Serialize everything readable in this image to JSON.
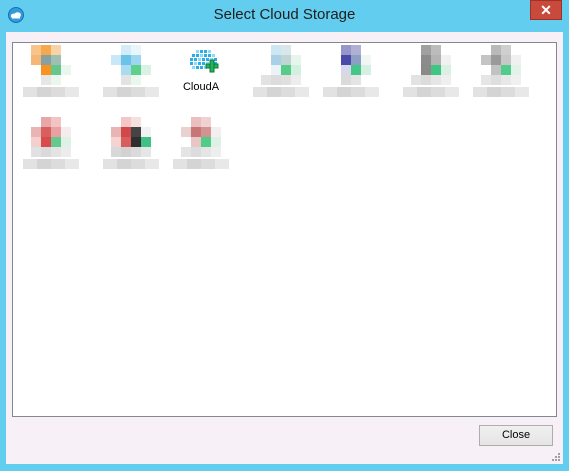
{
  "window": {
    "title": "Select Cloud Storage",
    "close_glyph": "✕"
  },
  "storage_items": [
    {
      "label": "",
      "icon": "blurred-icon",
      "colors": [
        "#f7c489",
        "#f6a94a",
        "#f8d3a8",
        "#fff",
        "#f4b776",
        "#88a0a4",
        "#9ec0b0",
        "#fff",
        "#fff",
        "#f7931e",
        "#66c78c",
        "#e9f7ef",
        "#fff",
        "#e6e6e6",
        "#eaf6ee",
        "#fff"
      ]
    },
    {
      "label": "",
      "icon": "blurred-icon",
      "colors": [
        "#fff",
        "#d3ecf8",
        "#e8f5fb",
        "#fff",
        "#c9e7f6",
        "#6cc3ea",
        "#9fd6ef",
        "#fff",
        "#fff",
        "#a9dbf1",
        "#5fcf8e",
        "#d8f3e4",
        "#fff",
        "#e3e3e3",
        "#e9f7ef",
        "#fff"
      ]
    },
    {
      "label": "CloudA",
      "icon": "clouda-icon",
      "colors": []
    },
    {
      "label": "",
      "icon": "blurred-icon",
      "colors": [
        "#fff",
        "#cce6f2",
        "#d9e6ea",
        "#fff",
        "#fff",
        "#a9d0e6",
        "#c1d6d4",
        "#e8f5ef",
        "#fff",
        "#eaf4f8",
        "#55cc88",
        "#d2f0df",
        "#e2e2e2",
        "#dcdcdc",
        "#e0e0e0",
        "#ededed"
      ]
    },
    {
      "label": "",
      "icon": "blurred-icon",
      "colors": [
        "#fff",
        "#9696c8",
        "#b0b0d4",
        "#fff",
        "#fff",
        "#4a4aa8",
        "#8e9fc6",
        "#f0f6f3",
        "#fff",
        "#d8d8ec",
        "#45c789",
        "#d5efe2",
        "#fff",
        "#dadada",
        "#e4e4e4",
        "#fff"
      ]
    },
    {
      "label": "",
      "icon": "blurred-icon",
      "colors": [
        "#fff",
        "#a0a0a0",
        "#bcbcbc",
        "#fff",
        "#fff",
        "#8c8c8c",
        "#b4b4b4",
        "#f1f1f1",
        "#fff",
        "#8a8a8a",
        "#3fc584",
        "#d9f0e3",
        "#e3e3e3",
        "#dcdcdc",
        "#e6e6e6",
        "#efefef"
      ]
    },
    {
      "label": "",
      "icon": "blurred-icon",
      "colors": [
        "#fff",
        "#b9b9b9",
        "#cfcfcf",
        "#fff",
        "#c4c4c4",
        "#9a9a9a",
        "#c8c8c8",
        "#f0f0f0",
        "#fff",
        "#c2c2c2",
        "#52cc8c",
        "#dff3e7",
        "#e6e6e6",
        "#dedede",
        "#e8e8e8",
        "#f0f0f0"
      ]
    },
    {
      "label": "",
      "icon": "blurred-icon",
      "colors": [
        "#fff",
        "#e9a6a6",
        "#f2c4c4",
        "#fff",
        "#e8b4b4",
        "#d95f5f",
        "#e8a0a0",
        "#f5eded",
        "#f2d0d0",
        "#d94a4a",
        "#63c98f",
        "#dcf2e5",
        "#e1e1e1",
        "#dadada",
        "#e3e3e3",
        "#ececec"
      ]
    },
    {
      "label": "",
      "icon": "blurred-icon",
      "colors": [
        "#fff",
        "#f3c7c7",
        "#f5e0e0",
        "#fff",
        "#e8b5b5",
        "#d04848",
        "#444444",
        "#f2f2f2",
        "#f4d3d3",
        "#d85d5d",
        "#2f2f2f",
        "#3ec283",
        "#d8d8d8",
        "#d2d2d2",
        "#dadada",
        "#e6e6e6"
      ]
    },
    {
      "label": "",
      "icon": "blurred-icon",
      "colors": [
        "#fff",
        "#ebbfbf",
        "#efd1d1",
        "#fff",
        "#ead1d1",
        "#c77575",
        "#d39393",
        "#f4efef",
        "#fff",
        "#e8c6c6",
        "#4fcb8a",
        "#ddf2e5",
        "#e4e4e4",
        "#dcdcdc",
        "#e5e5e5",
        "#eeeeee"
      ]
    }
  ],
  "buttons": {
    "close_label": "Close"
  },
  "colors": {
    "frame": "#63cdf0",
    "close_button": "#c74a3d"
  }
}
